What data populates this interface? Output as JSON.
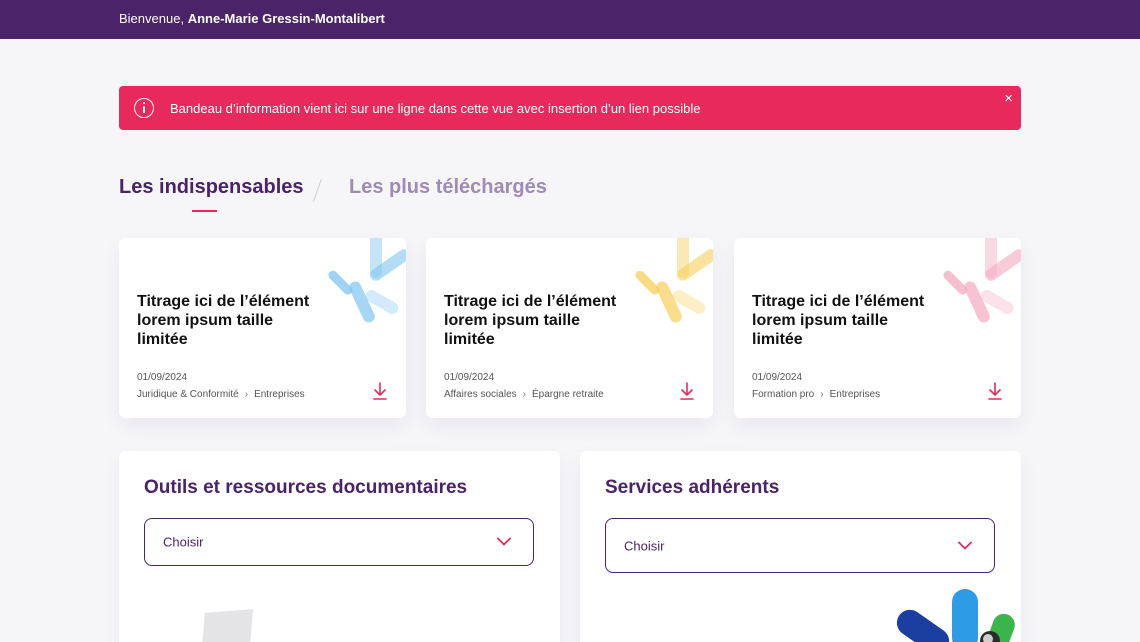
{
  "header": {
    "welcome_prefix": "Bienvenue,",
    "user_name": "Anne-Marie Gressin-Montalibert"
  },
  "banner": {
    "text": "Bandeau d’information vient ici sur une ligne dans cette vue avec insertion d’un lien possible",
    "close_label": "×"
  },
  "tabs": [
    {
      "label": "Les indispensables",
      "active": true
    },
    {
      "label": "Les plus téléchargés",
      "active": false
    }
  ],
  "cards": [
    {
      "title": "Titrage ici de l’élément lorem ipsum taille limitée",
      "date": "01/09/2024",
      "category": "Juridique & Conformité",
      "subcategory": "Entreprises",
      "accent": "#7fc4ef"
    },
    {
      "title": "Titrage ici de l’élément lorem ipsum taille limitée",
      "date": "01/09/2024",
      "category": "Affaires sociales",
      "subcategory": "Épargne retraite",
      "accent": "#f7cf5a"
    },
    {
      "title": "Titrage ici de l’élément lorem ipsum taille limitée",
      "date": "01/09/2024",
      "category": "Formation pro",
      "subcategory": "Entreprises",
      "accent": "#f3a9bf"
    }
  ],
  "panels": [
    {
      "title": "Outils et ressources documentaires",
      "select_placeholder": "Choisir"
    },
    {
      "title": "Services adhérents",
      "select_placeholder": "Choisir"
    }
  ],
  "colors": {
    "brand_purple": "#4a2368",
    "accent_pink": "#e8295c",
    "background": "#f6f5f8"
  }
}
